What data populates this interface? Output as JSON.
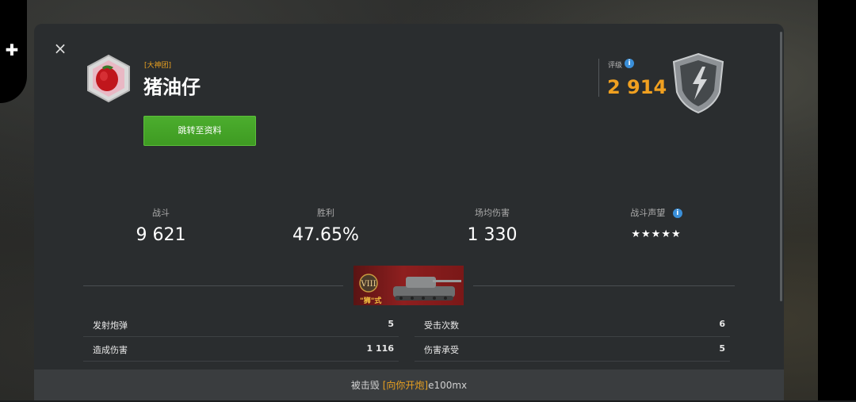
{
  "panel": {
    "close_icon": "×"
  },
  "player": {
    "clan_tag": "[大神团]",
    "name": "猪油仔"
  },
  "profile_button": {
    "label": "跳转至资料"
  },
  "rating": {
    "label": "评级",
    "value": "2 914"
  },
  "stats": [
    {
      "label": "战斗",
      "value": "9 621"
    },
    {
      "label": "胜利",
      "value": "47.65%"
    },
    {
      "label": "场均伤害",
      "value": "1 330"
    },
    {
      "label": "战斗声望",
      "value": "★★★★★"
    }
  ],
  "tank": {
    "tier": "VIII",
    "name": "\"狮\"式"
  },
  "details": [
    {
      "label": "发射炮弹",
      "value": "5"
    },
    {
      "label": "受击次数",
      "value": "6"
    },
    {
      "label": "造成伤害",
      "value": "1 116"
    },
    {
      "label": "伤害承受",
      "value": "5"
    }
  ],
  "footer": {
    "prefix": "被击毁",
    "clan": "[向你开炮]",
    "player": "e100mx"
  },
  "colors": {
    "accent_orange": "#f0a020",
    "green_button": "#4cae2e",
    "info_blue": "#3a8fd9",
    "tank_card_red": "#8e1f1f"
  }
}
